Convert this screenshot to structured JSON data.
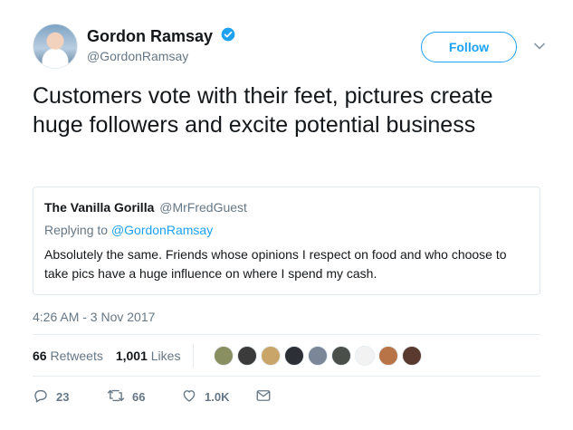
{
  "author": {
    "display_name": "Gordon Ramsay",
    "handle": "@GordonRamsay",
    "verified": true
  },
  "follow_button": {
    "label": "Follow"
  },
  "tweet": {
    "text": "Customers vote with their feet, pictures create huge followers and excite potential business",
    "timestamp": "4:26 AM - 3 Nov 2017"
  },
  "quoted_tweet": {
    "display_name": "The Vanilla Gorilla",
    "handle": "@MrFredGuest",
    "replying_prefix": "Replying to ",
    "replying_to": "@GordonRamsay",
    "text": "Absolutely the same. Friends whose opinions I respect on food and who choose to take pics have a huge influence on where I spend my cash."
  },
  "stats": {
    "retweets_count": "66",
    "retweets_label": "Retweets",
    "likes_count": "1,001",
    "likes_label": "Likes"
  },
  "likers": [
    {
      "name": "liker-1",
      "color": "#8a8f62"
    },
    {
      "name": "liker-2",
      "color": "#3b3b3b"
    },
    {
      "name": "liker-3",
      "color": "#c9a56a"
    },
    {
      "name": "liker-4",
      "color": "#2d2f36"
    },
    {
      "name": "liker-5",
      "color": "#7b8799"
    },
    {
      "name": "liker-6",
      "color": "#4b4f4a"
    },
    {
      "name": "liker-7",
      "color": "#f2f2f2"
    },
    {
      "name": "liker-8",
      "color": "#b87446"
    },
    {
      "name": "liker-9",
      "color": "#5a3a2e"
    }
  ],
  "actions": {
    "reply_count": "23",
    "retweet_count": "66",
    "like_count": "1.0K"
  },
  "colors": {
    "brand_blue": "#1da1f2",
    "secondary_text": "#657786",
    "border": "#e1e8ed"
  },
  "icons": {
    "verified": "verified-badge-icon",
    "caret": "chevron-down-icon",
    "reply": "reply-icon",
    "retweet": "retweet-icon",
    "like": "heart-icon",
    "dm": "envelope-icon"
  }
}
